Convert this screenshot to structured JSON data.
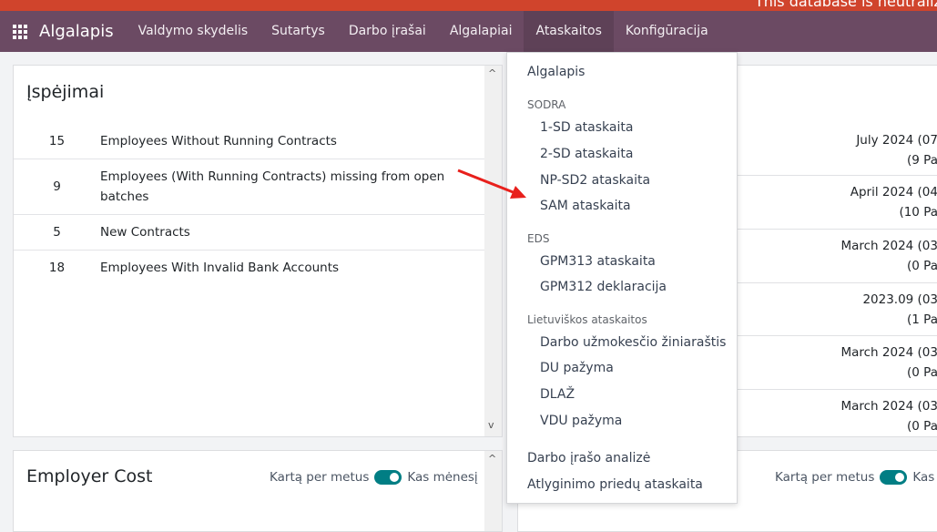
{
  "banner": {
    "text": "This database is neutralized."
  },
  "navbar": {
    "app": "Algalapis",
    "menu": [
      "Valdymo skydelis",
      "Sutartys",
      "Darbo įrašai",
      "Algalapiai",
      "Ataskaitos",
      "Konfigūracija"
    ],
    "active": "Ataskaitos"
  },
  "warnings": {
    "title": "Įspėjimai",
    "rows": [
      {
        "count": "15",
        "label": "Employees Without Running Contracts"
      },
      {
        "count": "9",
        "label": "Employees (With Running Contracts) missing from open batches"
      },
      {
        "count": "5",
        "label": "New Contracts"
      },
      {
        "count": "18",
        "label": "Employees With Invalid Bank Accounts"
      }
    ]
  },
  "employer_cost": {
    "title": "Employer Cost",
    "toggle_left": "Kartą per metus",
    "toggle_right": "Kas mėnesį",
    "toggle_on": true
  },
  "right_panel": {
    "rows": [
      {
        "line1": "July 2024 (07",
        "line2": "(9 Pa"
      },
      {
        "line1": "April 2024 (04",
        "line2": "(10 Pa"
      },
      {
        "line1": "March 2024 (03",
        "line2": "(0 Pa"
      },
      {
        "line1": "2023.09 (03",
        "line2": "(1 Pa"
      },
      {
        "line1": "March 2024 (03",
        "line2": "(0 Pa"
      },
      {
        "line1": "March 2024 (03",
        "line2": "(0 Pa"
      }
    ],
    "toggle_left": "Kartą per metus",
    "toggle_right": "Kas m"
  },
  "dropdown": {
    "algalapis": "Algalapis",
    "sodra_header": "SODRA",
    "sodra": [
      "1-SD ataskaita",
      "2-SD ataskaita",
      "NP-SD2 ataskaita",
      "SAM ataskaita"
    ],
    "eds_header": "EDS",
    "eds": [
      "GPM313 ataskaita",
      "GPM312 deklaracija"
    ],
    "lt_header": "Lietuviškos ataskaitos",
    "lt": [
      "Darbo užmokesčio žiniaraštis",
      "DU pažyma",
      "DLAŽ",
      "VDU pažyma"
    ],
    "analysis": "Darbo įrašo analizė",
    "bonus": "Atlyginimo priedų ataskaita"
  },
  "colors": {
    "navbar": "#6b4a63",
    "banner": "#d0442c",
    "toggle": "#017e84",
    "arrow": "#e8201c"
  }
}
